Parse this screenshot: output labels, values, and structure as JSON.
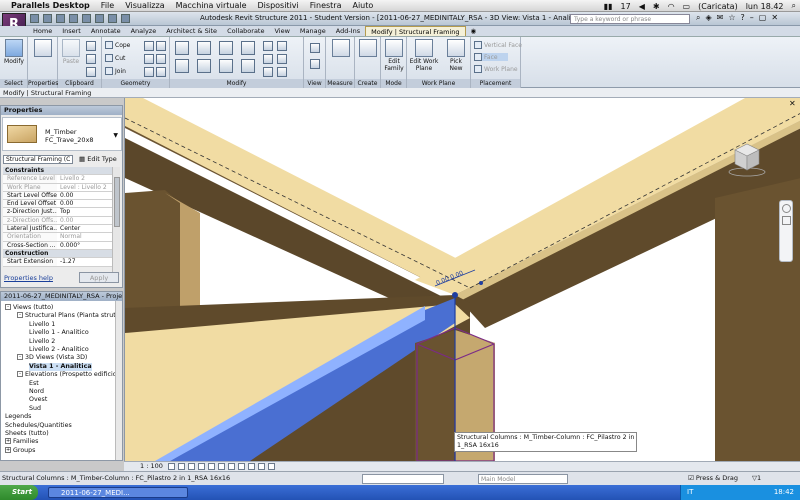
{
  "mac_menu": {
    "app": "Parallels Desktop",
    "items": [
      "File",
      "Visualizza",
      "Macchina virtuale",
      "Dispositivi",
      "Finestra",
      "Aiuto"
    ],
    "status": {
      "badge": "17",
      "battery": "(Caricata)",
      "clock": "lun 18.42"
    }
  },
  "window": {
    "title": "Autodesk Revit Structure 2011 - Student Version - [2011-06-27_MEDINITALY_RSA - 3D View: Vista 1 - Analitica]",
    "search_placeholder": "Type a keyword or phrase"
  },
  "ribbon": {
    "tabs": [
      "Home",
      "Insert",
      "Annotate",
      "Analyze",
      "Architect & Site",
      "Collaborate",
      "View",
      "Manage",
      "Add-Ins",
      "Modify | Structural Framing"
    ],
    "active_tab": "Modify | Structural Framing",
    "select_panel": {
      "modify": "Modify",
      "label": "Select"
    },
    "properties_panel": {
      "label": "Properties",
      "btn": "Properties"
    },
    "clipboard_panel": {
      "paste": "Paste",
      "label": "Clipboard"
    },
    "geometry_panel": {
      "cope": "Cope",
      "cut": "Cut",
      "join": "Join",
      "label": "Geometry"
    },
    "modify_panel": {
      "label": "Modify"
    },
    "view_panel": {
      "label": "View"
    },
    "measure_panel": {
      "label": "Measure"
    },
    "create_panel": {
      "label": "Create"
    },
    "mode_panel": {
      "edit_family": "Edit Family",
      "label": "Mode"
    },
    "workplane_panel": {
      "edit_work_plane": "Edit Work Plane",
      "pick_new": "Pick New",
      "label": "Work Plane"
    },
    "placement_panel": {
      "vertical_face": "Vertical Face",
      "face": "Face",
      "work_plane": "Work Plane",
      "label": "Placement"
    }
  },
  "context_bar": "Modify | Structural Framing",
  "properties": {
    "header": "Properties",
    "type_name_1": "M_Timber",
    "type_name_2": "FC_Trave_20x8",
    "family_dropdown": "Structural Framing (C",
    "edit_type": "Edit Type",
    "rows": [
      {
        "kind": "sect",
        "k": "Constraints"
      },
      {
        "kind": "grey",
        "k": "Reference Level",
        "v": "Livello 2"
      },
      {
        "kind": "grey",
        "k": "Work Plane",
        "v": "Level : Livello 2"
      },
      {
        "kind": "norm",
        "k": "Start Level Offset",
        "v": "0.00"
      },
      {
        "kind": "norm",
        "k": "End Level Offset",
        "v": "0.00"
      },
      {
        "kind": "norm",
        "k": "z-Direction Just...",
        "v": "Top"
      },
      {
        "kind": "grey",
        "k": "z-Direction Offs...",
        "v": "0.00"
      },
      {
        "kind": "norm",
        "k": "Lateral Justifica...",
        "v": "Center"
      },
      {
        "kind": "grey",
        "k": "Orientation",
        "v": "Normal"
      },
      {
        "kind": "norm",
        "k": "Cross-Section ...",
        "v": "0.000°"
      },
      {
        "kind": "sect",
        "k": "Construction"
      },
      {
        "kind": "norm",
        "k": "Start Extension",
        "v": "-1.27"
      }
    ],
    "help": "Properties help",
    "apply": "Apply"
  },
  "project_browser": {
    "header": "2011-06-27_MEDINITALY_RSA - Project Br",
    "items": [
      {
        "label": "Views (tutto)",
        "level": 0,
        "box": "-"
      },
      {
        "label": "Structural Plans (Pianta struttu",
        "level": 1,
        "box": "-"
      },
      {
        "label": "Livello 1",
        "level": 2,
        "box": ""
      },
      {
        "label": "Livello 1 - Analitico",
        "level": 2,
        "box": ""
      },
      {
        "label": "Livello 2",
        "level": 2,
        "box": ""
      },
      {
        "label": "Livello 2 - Analitico",
        "level": 2,
        "box": ""
      },
      {
        "label": "3D Views (Vista 3D)",
        "level": 1,
        "box": "-"
      },
      {
        "label": "Vista 1 - Analitica",
        "level": 2,
        "box": "",
        "selected": true
      },
      {
        "label": "Elevations (Prospetto edificio)",
        "level": 1,
        "box": "-"
      },
      {
        "label": "Est",
        "level": 2,
        "box": ""
      },
      {
        "label": "Nord",
        "level": 2,
        "box": ""
      },
      {
        "label": "Ovest",
        "level": 2,
        "box": ""
      },
      {
        "label": "Sud",
        "level": 2,
        "box": ""
      },
      {
        "label": "Legends",
        "level": 0,
        "box": ""
      },
      {
        "label": "Schedules/Quantities",
        "level": 0,
        "box": ""
      },
      {
        "label": "Sheets (tutto)",
        "level": 0,
        "box": ""
      },
      {
        "label": "Families",
        "level": 0,
        "box": "+"
      },
      {
        "label": "Groups",
        "level": 0,
        "box": "+"
      }
    ]
  },
  "viewport": {
    "tooltip_1": "Structural Columns : M_Timber-Column : FC_Pilastro 2 in",
    "tooltip_2": "1_RSA 16x16",
    "dimension": "0.00 0.00",
    "cube_face": "FRONT"
  },
  "view_control": {
    "scale": "1 : 100"
  },
  "status_bar": {
    "text": "Structural Columns : M_Timber-Column : FC_Pilastro 2 in 1_RSA 16x16",
    "model": "Main Model",
    "press_drag": "Press & Drag",
    "filter_count": "1"
  },
  "taskbar": {
    "start": "Start",
    "app": "2011-06-27_MEDI...",
    "lang": "IT",
    "clock": "18:42"
  },
  "colors": {
    "wood_light": "#f1dca3",
    "wood_dark": "#6a5330",
    "selection_blue": "#4a6fd2",
    "purple": "#7b2b86"
  }
}
